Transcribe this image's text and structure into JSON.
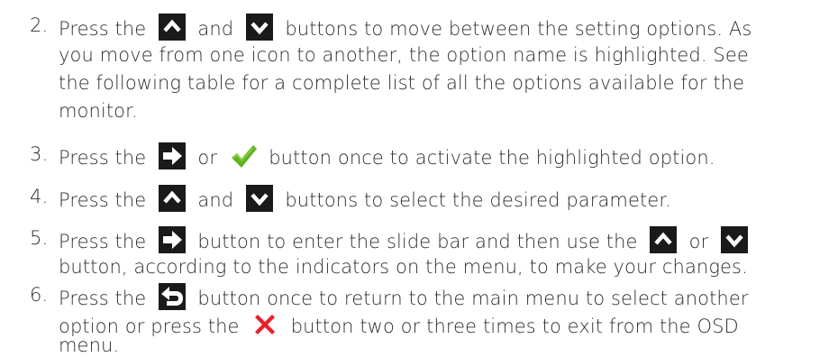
{
  "steps": [
    {
      "number": "2.",
      "lines": [
        {
          "parts": [
            "Press the ",
            " and ",
            " buttons to move between the setting options. As"
          ]
        },
        {
          "parts": [
            "you move from one icon to another, the option name is highlighted. See"
          ]
        },
        {
          "parts": [
            "the following table for a complete list of all the options available for the"
          ]
        },
        {
          "parts": [
            "monitor."
          ]
        }
      ],
      "icons": [
        "up-arrow-icon",
        "down-arrow-icon"
      ]
    },
    {
      "number": "3.",
      "lines": [
        {
          "parts": [
            "Press the ",
            " or ",
            " button once to activate the highlighted option."
          ]
        }
      ],
      "icons": [
        "right-arrow-icon",
        "checkmark-icon"
      ]
    },
    {
      "number": "4.",
      "lines": [
        {
          "parts": [
            "Press the ",
            " and ",
            " buttons to select the desired parameter."
          ]
        }
      ],
      "icons": [
        "up-arrow-icon",
        "down-arrow-icon"
      ]
    },
    {
      "number": "5.",
      "lines": [
        {
          "parts": [
            "Press the ",
            " button to enter the slide bar and then use the ",
            " or ",
            ""
          ]
        },
        {
          "parts": [
            "button, according to the indicators on the menu, to make your changes."
          ]
        }
      ],
      "icons": [
        "right-arrow-icon",
        "up-arrow-icon",
        "down-arrow-icon"
      ]
    },
    {
      "number": "6.",
      "lines": [
        {
          "parts": [
            "Press the ",
            " button once to return to the main menu to select another"
          ]
        },
        {
          "parts": [
            "option or press the ",
            " button two or three times to exit from the OSD"
          ]
        },
        {
          "parts": [
            "menu."
          ]
        }
      ],
      "icons": [
        "back-arrow-icon",
        "close-icon"
      ]
    }
  ],
  "colors": {
    "text": "#2e2e2e",
    "button_bg": "#1a1a1a",
    "check_green": "#62b31f",
    "close_red": "#e8202a",
    "arrow_white": "#ffffff"
  }
}
